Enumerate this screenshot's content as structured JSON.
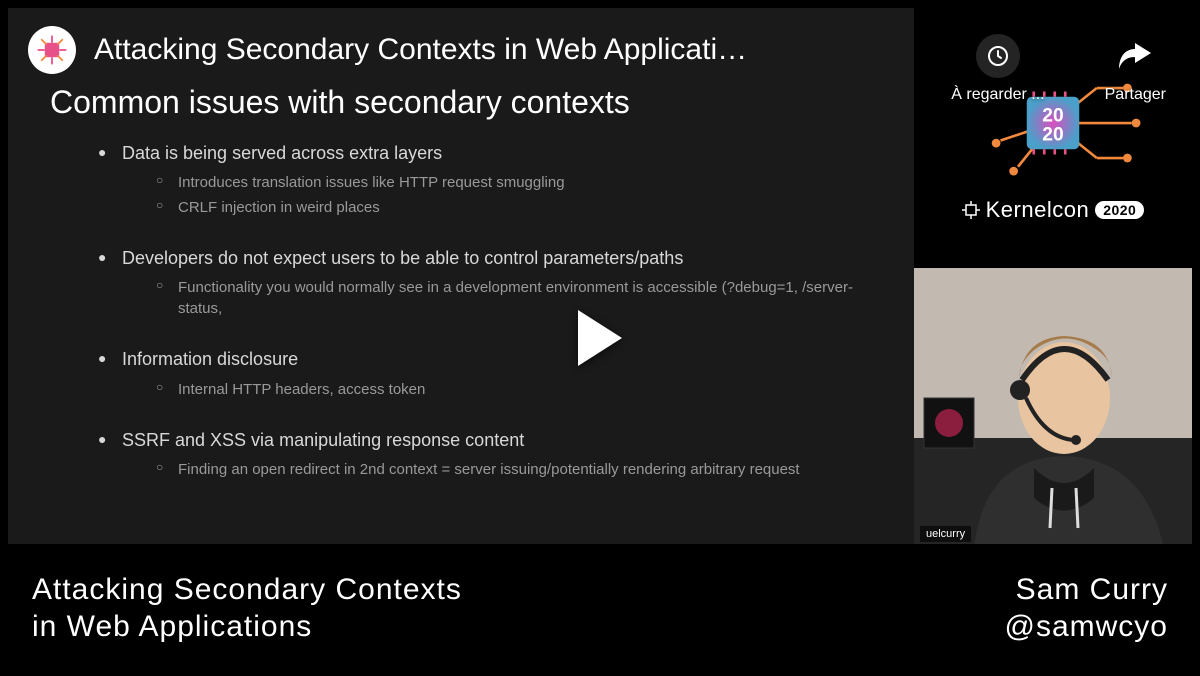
{
  "video": {
    "title": "Attacking Secondary Contexts in Web Applicati…"
  },
  "overlay": {
    "watch_later": "À regarder ...",
    "share": "Partager"
  },
  "slide": {
    "heading": "Common issues with secondary contexts",
    "b1": "Data is being served across extra layers",
    "b1s1": "Introduces translation issues like HTTP request smuggling",
    "b1s2": "CRLF injection in weird places",
    "b2": "Developers do not expect users to be able to control parameters/paths",
    "b2s1": "Functionality you would normally see in a development environment is accessible (?debug=1, /server-status,",
    "b3": "Information disclosure",
    "b3s1": "Internal HTTP headers, access token",
    "b4": "SSRF and XSS via manipulating response content",
    "b4s1": "Finding an open redirect in 2nd context = server issuing/potentially rendering arbitrary request"
  },
  "branding": {
    "name": "Kernelcon",
    "year": "2020"
  },
  "presenter": {
    "name_tag": "uelcurry"
  },
  "footer": {
    "talk_title_line1": "Attacking Secondary Contexts",
    "talk_title_line2": "in Web Applications",
    "speaker_name": "Sam Curry",
    "speaker_handle": "@samwcyo"
  }
}
